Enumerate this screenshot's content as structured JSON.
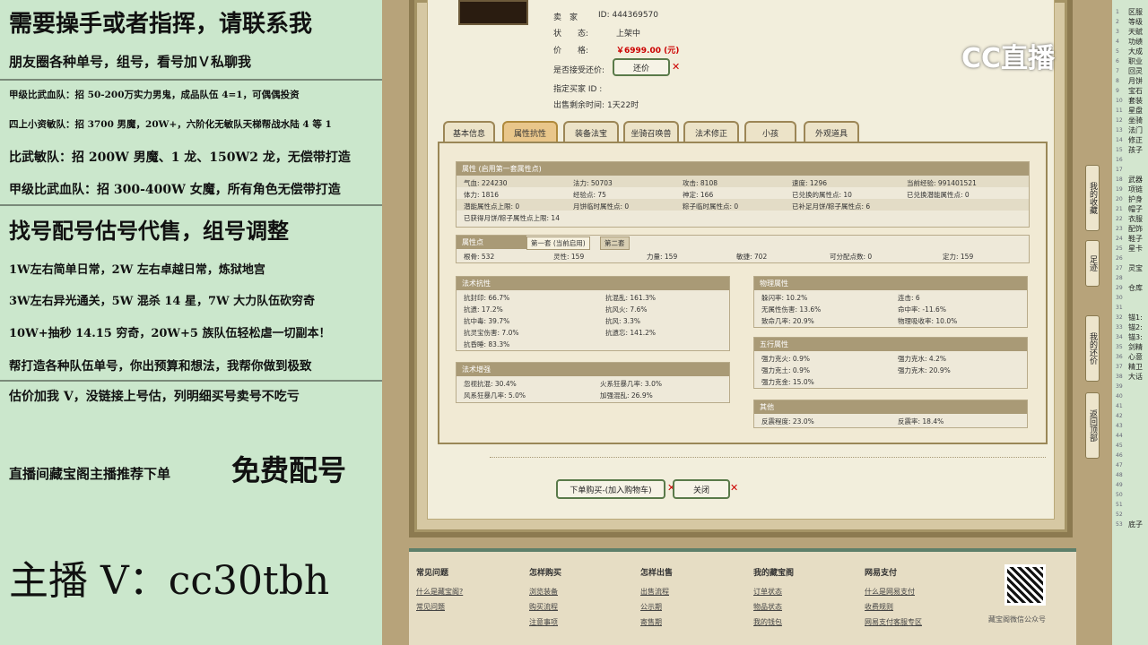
{
  "left_panel": {
    "lines": [
      "需要操手或者指挥，请联系我",
      "朋友圈各种单号，组号，看号加Ｖ私聊我",
      "甲级比武血队：招 50-200万实力男鬼，成品队伍 4=1，可偶偶投资",
      "四上小资敏队：招 3700 男魔，20W+，六阶化无敏队天梯帮战水陆 4 等 1",
      "比武敏队：招 200W 男魔、1 龙、150W2 龙，无偿带打造",
      "甲级比武血队：招 300-400W 女魔，所有角色无偿带打造",
      "找号配号估号代售，组号调整",
      "1W左右简单日常，2W 左右卓越日常，炼狱地宫",
      "3W左右异光通关，5W 混杀 14 星，7W 大力队伍砍穷奇",
      "10W+抽秒 14.15 穷奇，20W+5 族队伍轻松虐一切副本！",
      "帮打造各种队伍单号，你出预算和想法，我帮你做到极致",
      "估价加我 V，没链接上号估，列明细买号卖号不吃亏",
      "直播间藏宝阁主播推荐下单",
      "免费配号",
      "主播 V：cc30tbh"
    ]
  },
  "seller": {
    "seller_label": "卖　家",
    "seller_id": "ID:  444369570",
    "status_label": "状　　态:",
    "status_value": "上架中",
    "price_label": "价　　格:",
    "price_value": "￥6999.00 (元)",
    "bargain_label": "是否接受还价:",
    "bargain_button": "还价",
    "designated_label": "指定买家 ID :",
    "remaining_label": "出售剩余时间:",
    "remaining_value": "1天22时"
  },
  "tabs": [
    "基本信息",
    "属性抗性",
    "装备法宝",
    "坐骑召唤兽",
    "法术修正",
    "小孩",
    "外观道具"
  ],
  "attr": {
    "header": "属性 (启用第一套属性点)",
    "rows": [
      [
        "气血: 224230",
        "法力: 50703",
        "攻击: 8108",
        "速度: 1296",
        "当前经验: 991401521"
      ],
      [
        "体力: 1816",
        "经验点: 75",
        "神定: 166",
        "已兑换的属性点: 10",
        "已兑换潜能属性点: 0"
      ],
      [
        "潜能属性点上限: 0",
        "月饼临时属性点: 0",
        "粽子临时属性点: 0",
        "已补足月饼/粽子属性点: 6",
        ""
      ],
      [
        "已获得月饼/粽子属性点上限: 14",
        "",
        "",
        "",
        ""
      ]
    ]
  },
  "points": {
    "header": "属性点",
    "tab1": "第一套 (当前启用)",
    "tab2": "第二套",
    "values": [
      "根骨: 532",
      "灵性: 159",
      "力量: 159",
      "敏捷: 702",
      "可分配点数: 0",
      "定力: 159"
    ]
  },
  "resist": {
    "header": "法术抗性",
    "rows": [
      [
        "抗封印: 66.7%",
        "抗混乱: 161.3%"
      ],
      [
        "抗遗: 17.2%",
        "抗风火: 7.6%"
      ],
      [
        "抗中毒: 39.7%",
        "抗风: 3.3%"
      ],
      [
        "抗灵宝伤害: 7.0%",
        "抗遗忘: 141.2%"
      ],
      [
        "抗昏睡: 83.3%",
        ""
      ]
    ]
  },
  "boost": {
    "header": "法术增强",
    "rows": [
      [
        "忽视抗混: 30.4%",
        "火系狂暴几率: 3.0%"
      ],
      [
        "风系狂暴几率: 5.0%",
        "加强混乱: 26.9%"
      ]
    ]
  },
  "physical": {
    "header": "物理属性",
    "rows": [
      [
        "躲闪率: 10.2%",
        "连击: 6"
      ],
      [
        "无属性伤害: 13.6%",
        "命中率: -11.6%"
      ],
      [
        "致命几率: 20.9%",
        "物理吸收率: 10.0%"
      ]
    ]
  },
  "elements": {
    "header": "五行属性",
    "rows": [
      [
        "强力克火: 0.9%",
        "强力克水: 4.2%"
      ],
      [
        "强力克土: 0.9%",
        "强力克木: 20.9%"
      ],
      [
        "强力克金: 15.0%",
        ""
      ]
    ]
  },
  "other": {
    "header": "其他",
    "rows": [
      [
        "反震程度: 23.0%",
        "反震率: 18.4%"
      ]
    ]
  },
  "actions": {
    "buy": "下单购买-(加入购物车)",
    "close": "关闭"
  },
  "side_buttons": [
    "我的收藏",
    "足迹",
    "我的还价",
    "返回顶部"
  ],
  "footer": {
    "cols": [
      {
        "title": "常见问题",
        "links": [
          "什么是藏宝阁?",
          "常见问题"
        ]
      },
      {
        "title": "怎样购买",
        "links": [
          "浏览装备",
          "购买流程",
          "注意事项"
        ]
      },
      {
        "title": "怎样出售",
        "links": [
          "出售流程",
          "公示期",
          "寄售期"
        ]
      },
      {
        "title": "我的藏宝阁",
        "links": [
          "订单状态",
          "物品状态",
          "我的钱包"
        ]
      },
      {
        "title": "网易支付",
        "links": [
          "什么是网易支付",
          "收费规则",
          "网易支付客服专区"
        ]
      }
    ],
    "qr_caption": "藏宝阁微信公众号"
  },
  "logo": "CC直播",
  "right_list": [
    "区服",
    "等级",
    "天赋",
    "功绩",
    "大成",
    "职业",
    "回灵",
    "月饼",
    "宝石",
    "套装",
    "星盘",
    "坐骑",
    "法门",
    "修正",
    "孩子",
    "",
    "",
    "武器",
    "项链",
    "护身",
    "帽子",
    "衣服",
    "配饰",
    "鞋子",
    "星卡",
    "",
    "灵宝",
    "",
    "仓库",
    "",
    "",
    "锚1:",
    "锚2:",
    "锚3:",
    "剑精",
    "心意",
    "精卫",
    "大话",
    "",
    "",
    "",
    "",
    "",
    "",
    "",
    "",
    "",
    "",
    "",
    "",
    "",
    "",
    "底子"
  ],
  "colors": {
    "accent": "#5a7a4a",
    "price": "#c00000",
    "header_bg": "#a99a76"
  }
}
